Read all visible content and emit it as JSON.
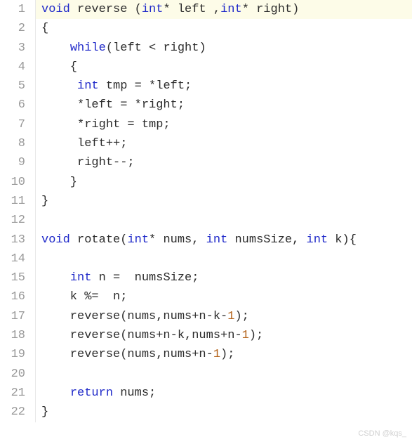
{
  "watermark": "CSDN @kqs_",
  "lines": [
    {
      "n": "1",
      "tokens": [
        {
          "t": "void",
          "c": "kw"
        },
        {
          "t": " reverse (",
          "c": "txt"
        },
        {
          "t": "int",
          "c": "kw"
        },
        {
          "t": "* left ,",
          "c": "txt"
        },
        {
          "t": "int",
          "c": "kw"
        },
        {
          "t": "* right)",
          "c": "txt"
        }
      ],
      "hl": true
    },
    {
      "n": "2",
      "tokens": [
        {
          "t": "{",
          "c": "txt"
        }
      ]
    },
    {
      "n": "3",
      "tokens": [
        {
          "t": "    ",
          "c": "txt"
        },
        {
          "t": "while",
          "c": "kw"
        },
        {
          "t": "(left < right)",
          "c": "txt"
        }
      ]
    },
    {
      "n": "4",
      "tokens": [
        {
          "t": "    {",
          "c": "txt"
        }
      ]
    },
    {
      "n": "5",
      "tokens": [
        {
          "t": "     ",
          "c": "txt"
        },
        {
          "t": "int",
          "c": "kw"
        },
        {
          "t": " tmp = *left;",
          "c": "txt"
        }
      ]
    },
    {
      "n": "6",
      "tokens": [
        {
          "t": "     *left = *right;",
          "c": "txt"
        }
      ]
    },
    {
      "n": "7",
      "tokens": [
        {
          "t": "     *right = tmp;",
          "c": "txt"
        }
      ]
    },
    {
      "n": "8",
      "tokens": [
        {
          "t": "     left++;",
          "c": "txt"
        }
      ]
    },
    {
      "n": "9",
      "tokens": [
        {
          "t": "     right--;",
          "c": "txt"
        }
      ]
    },
    {
      "n": "10",
      "tokens": [
        {
          "t": "    }",
          "c": "txt"
        }
      ]
    },
    {
      "n": "11",
      "tokens": [
        {
          "t": "}",
          "c": "txt"
        }
      ]
    },
    {
      "n": "12",
      "tokens": []
    },
    {
      "n": "13",
      "tokens": [
        {
          "t": "void",
          "c": "kw"
        },
        {
          "t": " rotate(",
          "c": "txt"
        },
        {
          "t": "int",
          "c": "kw"
        },
        {
          "t": "* nums, ",
          "c": "txt"
        },
        {
          "t": "int",
          "c": "kw"
        },
        {
          "t": " numsSize, ",
          "c": "txt"
        },
        {
          "t": "int",
          "c": "kw"
        },
        {
          "t": " k){",
          "c": "txt"
        }
      ]
    },
    {
      "n": "14",
      "tokens": []
    },
    {
      "n": "15",
      "tokens": [
        {
          "t": "    ",
          "c": "txt"
        },
        {
          "t": "int",
          "c": "kw"
        },
        {
          "t": " n =  numsSize;",
          "c": "txt"
        }
      ]
    },
    {
      "n": "16",
      "tokens": [
        {
          "t": "    k %=  n;",
          "c": "txt"
        }
      ]
    },
    {
      "n": "17",
      "tokens": [
        {
          "t": "    reverse(nums,nums+n-k-",
          "c": "txt"
        },
        {
          "t": "1",
          "c": "num"
        },
        {
          "t": ");",
          "c": "txt"
        }
      ]
    },
    {
      "n": "18",
      "tokens": [
        {
          "t": "    reverse(nums+n-k,nums+n-",
          "c": "txt"
        },
        {
          "t": "1",
          "c": "num"
        },
        {
          "t": ");",
          "c": "txt"
        }
      ]
    },
    {
      "n": "19",
      "tokens": [
        {
          "t": "    reverse(nums,nums+n-",
          "c": "txt"
        },
        {
          "t": "1",
          "c": "num"
        },
        {
          "t": ");",
          "c": "txt"
        }
      ]
    },
    {
      "n": "20",
      "tokens": []
    },
    {
      "n": "21",
      "tokens": [
        {
          "t": "    ",
          "c": "txt"
        },
        {
          "t": "return",
          "c": "kw"
        },
        {
          "t": " nums;",
          "c": "txt"
        }
      ]
    },
    {
      "n": "22",
      "tokens": [
        {
          "t": "}",
          "c": "txt"
        }
      ]
    }
  ]
}
